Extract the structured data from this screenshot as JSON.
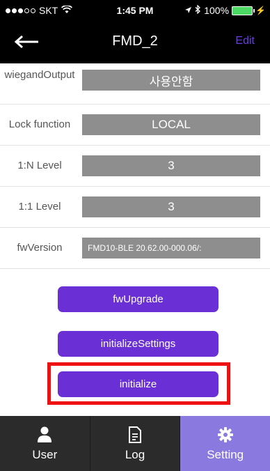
{
  "status_bar": {
    "carrier": "SKT",
    "time": "1:45 PM",
    "battery": "100%"
  },
  "nav": {
    "title": "FMD_2",
    "edit_label": "Edit"
  },
  "settings": [
    {
      "label": "wiegandOutput",
      "value": "사용안함"
    },
    {
      "label": "Lock function",
      "value": "LOCAL"
    },
    {
      "label": "1:N Level",
      "value": "3"
    },
    {
      "label": "1:1 Level",
      "value": "3"
    },
    {
      "label": "fwVersion",
      "value": "FMD10-BLE 20.62.00-000.06/:"
    }
  ],
  "buttons": {
    "fw_upgrade": "fwUpgrade",
    "initialize_settings": "initializeSettings",
    "initialize": "initialize"
  },
  "tabs": [
    {
      "label": "User",
      "icon": "person-icon"
    },
    {
      "label": "Log",
      "icon": "document-icon"
    },
    {
      "label": "Setting",
      "icon": "gear-icon"
    }
  ],
  "colors": {
    "accent": "#6a30d6",
    "highlight": "#ee1111",
    "active_tab": "#8a7ae0",
    "field_bg": "#8e8e8e"
  }
}
